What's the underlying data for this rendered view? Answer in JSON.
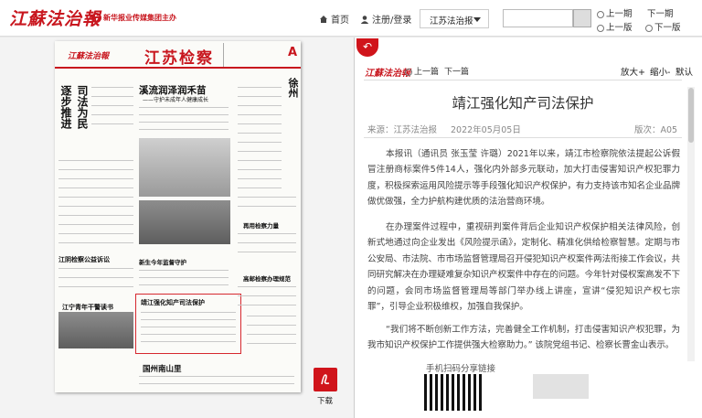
{
  "header": {
    "logo": "江蘇法治報",
    "sublogo": "新华报业传媒集团主办",
    "nav_home": "首页",
    "nav_login": "注册/登录",
    "edition_select": "江苏法治报",
    "prev_issue": "上一期",
    "next_issue": "下一期",
    "prev_page": "上一版",
    "next_page": "下一版"
  },
  "paper": {
    "masthead_left": "江蘇法治報",
    "masthead_title": "江苏检察",
    "page_label": "A",
    "headlines": [
      "溪流润泽润禾苗",
      "——守护未成年人健康成长",
      "逐步推进",
      "司法为民",
      "徐州",
      "新生今年监督守护",
      "靖江强化知产司法保护",
      "高邮检察办理规范",
      "江宁青年干警读书",
      "国州南山里"
    ]
  },
  "article_panel": {
    "logo": "江蘇法治報",
    "prev_article": "上一篇",
    "next_article": "下一篇",
    "zoom_in": "放大+",
    "zoom_out": "缩小-",
    "default": "默认",
    "title": "靖江强化知产司法保护",
    "source": "来源：江苏法治报",
    "date": "2022年05月05日",
    "edition": "版次：A05",
    "paragraphs": [
      "本报讯（通讯员 张玉莹 许璐）2021年以来，靖江市检察院依法提起公诉假冒注册商标案件5件14人，强化内外部多元联动，加大打击侵害知识产权犯罪力度，积极探索运用风险提示等手段强化知识产权保护，有力支持该市知名企业品牌做优做强，全力护航构建优质的法治营商环境。",
      "在办理案件过程中，重视研判案件背后企业知识产权保护相关法律风险，创新式地通过向企业发出《风险提示函》，定制化、精准化供给检察智慧。定期与市公安局、市法院、市市场监督管理局召开侵犯知识产权案件两法衔接工作会议，共同研究解决在办理疑难复杂知识产权案件中存在的问题。今年针对侵权案高发不下的问题，会同市场监督管理局等部门举办线上讲座，宣讲“侵犯知识产权七宗罪”，引导企业积极维权，加强自我保护。",
      "“我们将不断创新工作方法，完善健全工作机制，打击侵害知识产权犯罪，为我市知识产权保护工作提供强大检察助力。” 该院党组书记、检察长曹金山表示。"
    ],
    "share_label": "手机扫码分享链接",
    "download_label": "下载"
  }
}
